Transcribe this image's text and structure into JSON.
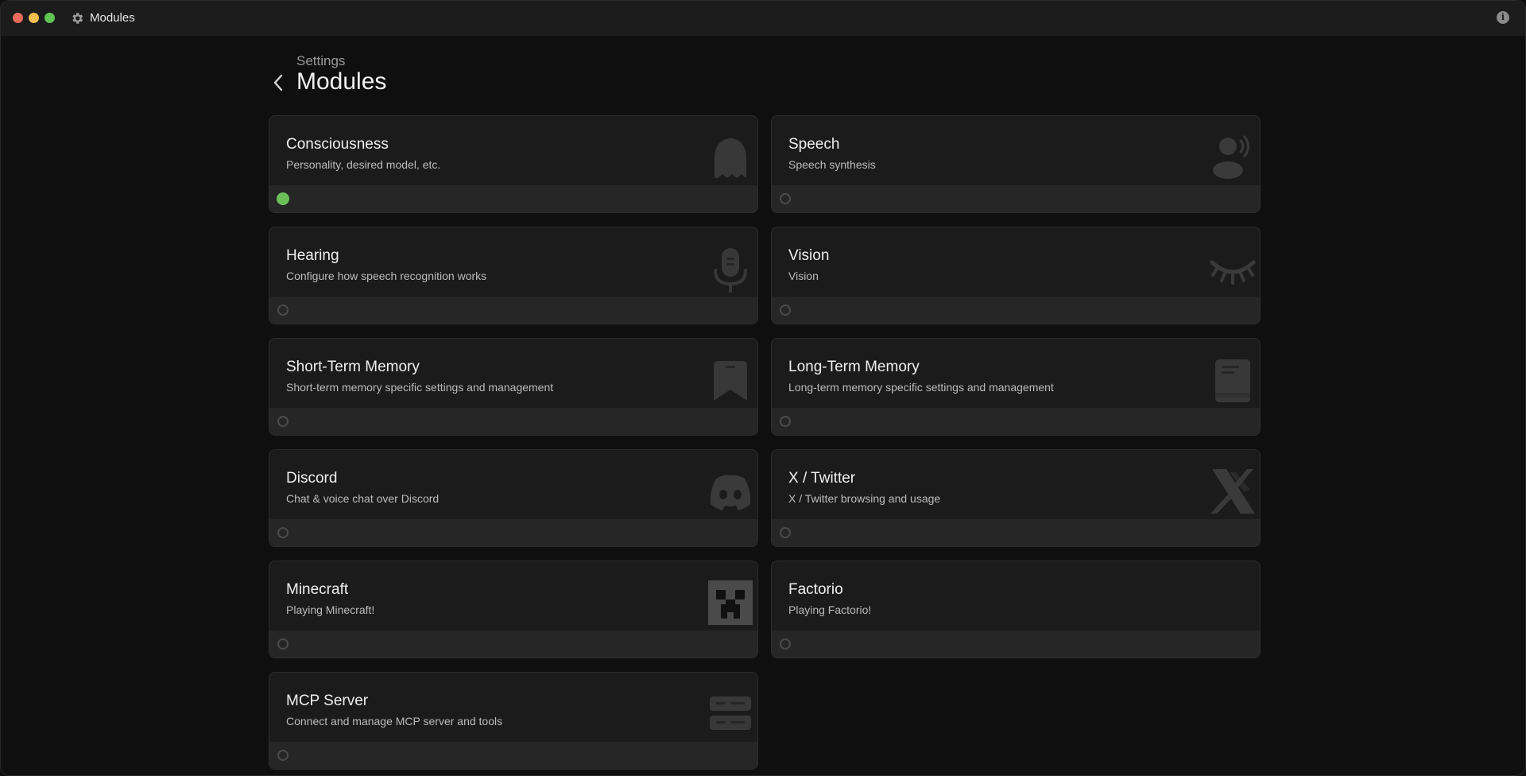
{
  "window": {
    "title": "Modules",
    "title_icon": "gear-icon",
    "info_label": "i"
  },
  "header": {
    "breadcrumb": "Settings",
    "title": "Modules",
    "back_icon": "chevron-left-icon"
  },
  "colors": {
    "active": "#6bbf59",
    "inactive_border": "#4a4a4a",
    "icon": "#3a3a3a"
  },
  "modules": [
    {
      "title": "Consciousness",
      "description": "Personality, desired model, etc.",
      "icon": "ghost-icon",
      "enabled": true
    },
    {
      "title": "Speech",
      "description": "Speech synthesis",
      "icon": "speaking-person-icon",
      "enabled": false
    },
    {
      "title": "Hearing",
      "description": "Configure how speech recognition works",
      "icon": "microphone-icon",
      "enabled": false
    },
    {
      "title": "Vision",
      "description": "Vision",
      "icon": "closed-eye-icon",
      "enabled": false
    },
    {
      "title": "Short-Term Memory",
      "description": "Short-term memory specific settings and management",
      "icon": "bookmark-icon",
      "enabled": false
    },
    {
      "title": "Long-Term Memory",
      "description": "Long-term memory specific settings and management",
      "icon": "book-icon",
      "enabled": false
    },
    {
      "title": "Discord",
      "description": "Chat & voice chat over Discord",
      "icon": "discord-icon",
      "enabled": false
    },
    {
      "title": "X / Twitter",
      "description": "X / Twitter browsing and usage",
      "icon": "x-logo-icon",
      "enabled": false
    },
    {
      "title": "Minecraft",
      "description": "Playing Minecraft!",
      "icon": "creeper-icon",
      "enabled": false
    },
    {
      "title": "Factorio",
      "description": "Playing Factorio!",
      "icon": "",
      "enabled": false
    },
    {
      "title": "MCP Server",
      "description": "Connect and manage MCP server and tools",
      "icon": "server-icon",
      "enabled": false
    }
  ]
}
